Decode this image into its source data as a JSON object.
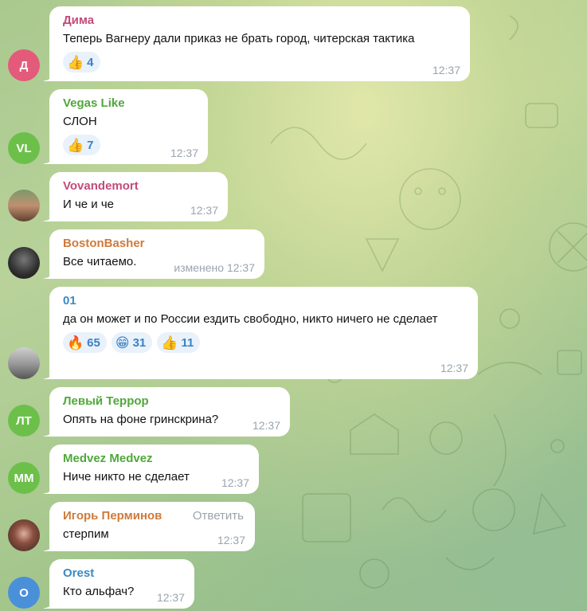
{
  "messages": [
    {
      "initials": "Д",
      "avatar_color": "#e35a7b",
      "name": "Дима",
      "name_color": "#c44a7a",
      "text": "Теперь Вагнеру дали приказ не брать город, читерская тактика",
      "reactions": [
        {
          "emoji": "👍",
          "count": "4"
        }
      ],
      "time": "12:37"
    },
    {
      "initials": "VL",
      "avatar_color": "#6cc04a",
      "name": "Vegas Like",
      "name_color": "#4fa83a",
      "text": "СЛОН",
      "reactions": [
        {
          "emoji": "👍",
          "count": "7"
        }
      ],
      "time": "12:37"
    },
    {
      "initials": "",
      "avatar_color": "#a08060",
      "name": "Vovandemort",
      "name_color": "#c44a7a",
      "text": "И че и че",
      "time": "12:37"
    },
    {
      "initials": "",
      "avatar_color": "#3a3a3a",
      "name": "BostonBasher",
      "name_color": "#d07a3a",
      "text": "Все читаемо.",
      "edited": "изменено",
      "time": "12:37"
    },
    {
      "initials": "",
      "avatar_color": "#9a9a9a",
      "name": "01",
      "name_color": "#3a8ac4",
      "text": "да он может и по России ездить свободно, никто ничего не сделает",
      "reactions": [
        {
          "emoji": "🔥",
          "count": "65"
        },
        {
          "emoji": "😁",
          "count": "31"
        },
        {
          "emoji": "👍",
          "count": "11"
        }
      ],
      "time": "12:37"
    },
    {
      "initials": "ЛТ",
      "avatar_color": "#6cc04a",
      "name": "Левый Террор",
      "name_color": "#4fa83a",
      "text": "Опять на фоне гринскрина?",
      "time": "12:37"
    },
    {
      "initials": "MM",
      "avatar_color": "#6cc04a",
      "name": "Medvez Medvez",
      "name_color": "#4fa83a",
      "text": "Ниче никто не сделает",
      "time": "12:37"
    },
    {
      "initials": "",
      "avatar_color": "#5a3a30",
      "name": "Игорь Перминов",
      "name_color": "#d07a3a",
      "reply_label": "Ответить",
      "text": "стерпим",
      "time": "12:37"
    },
    {
      "initials": "O",
      "avatar_color": "#4a90d9",
      "name": "Orest",
      "name_color": "#3a8ac4",
      "text": "Кто альфач?",
      "time": "12:37"
    }
  ]
}
